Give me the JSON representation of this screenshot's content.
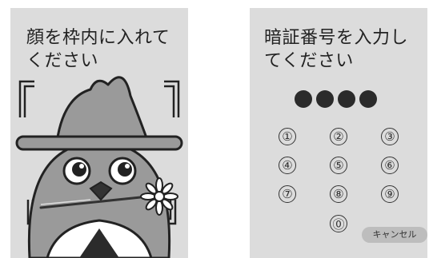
{
  "face_screen": {
    "instruction": "顔を枠内に入れてください"
  },
  "pin_screen": {
    "instruction": "暗証番号を入力してください",
    "entered_digits": 4,
    "keys": [
      "①",
      "②",
      "③",
      "④",
      "⑤",
      "⑥",
      "⑦",
      "⑧",
      "⑨",
      "⓪"
    ],
    "cancel_label": "キャンセル"
  },
  "colors": {
    "screen_background": "#dcdcdc",
    "mascot_body": "#9a9a9a",
    "ink": "#2b2b2b",
    "cancel_button": "#bdbdbd"
  }
}
